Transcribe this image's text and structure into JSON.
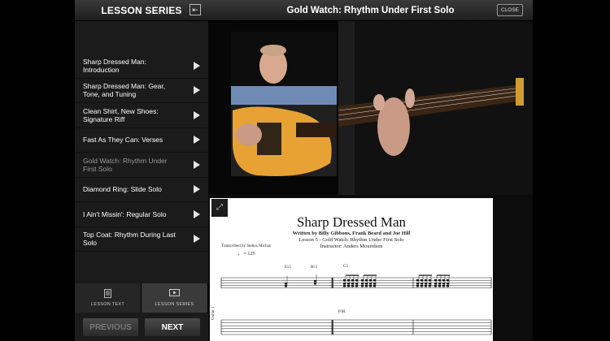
{
  "sidebar": {
    "title": "LESSON SERIES",
    "collapse_icon": "collapse-left-icon",
    "items": [
      {
        "label": "Sharp Dressed Man: Introduction",
        "active": false
      },
      {
        "label": "Sharp Dressed Man: Gear, Tone, and Tuning",
        "active": false
      },
      {
        "label": "Clean Shirt, New Shoes: Signature Riff",
        "active": false
      },
      {
        "label": "Fast As They Can: Verses",
        "active": false
      },
      {
        "label": "Gold Watch: Rhythm Under First Solo",
        "active": true
      },
      {
        "label": "Diamond Ring: Slide Solo",
        "active": false
      },
      {
        "label": "I Ain't Missin': Regular Solo",
        "active": false
      },
      {
        "label": "Top Coat: Rhythm During Last Solo",
        "active": false
      }
    ],
    "tabs": [
      {
        "label": "LESSON TEXT",
        "icon": "document-icon"
      },
      {
        "label": "LESSON SERIES",
        "icon": "video-icon",
        "selected": true
      }
    ],
    "prev_label": "PREVIOUS",
    "next_label": "NEXT"
  },
  "main": {
    "title": "Gold Watch: Rhythm Under First Solo",
    "close_label": "CLOSE"
  },
  "score": {
    "title": "Sharp Dressed Man",
    "credits": "Written by Billy Gibbons, Frank Beard and Joe Hill",
    "lesson": "Lesson 5 - Gold Watch: Rhythm Under First Solo",
    "instructor": "Instructor: Anders Mouridsen",
    "transcriber": "Transcribed by Stelios Michas",
    "tempo": "♩ = 125",
    "chords": [
      "E♭5",
      "B♭5",
      "C5"
    ],
    "pm": "P.M.",
    "guitar_label": "Guitar 1"
  }
}
